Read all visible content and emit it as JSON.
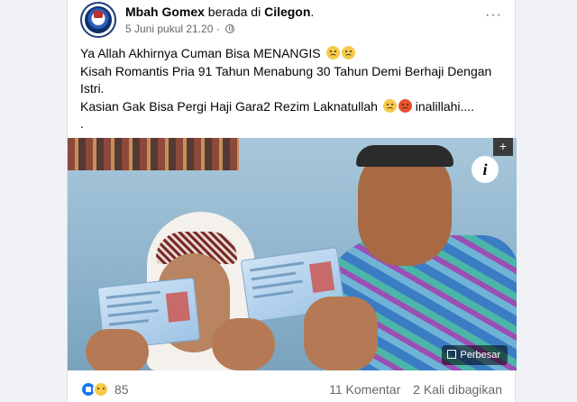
{
  "post": {
    "author": "Mbah Gomex",
    "location_prefix": "berada di",
    "location": "Cilegon",
    "location_suffix": ".",
    "timestamp": "5 Juni pukul 21.20",
    "separator": "·",
    "more_label": "···",
    "text_lines": [
      "Ya Allah Akhirnya Cuman Bisa MENANGIS",
      "Kisah Romantis Pria 91 Tahun Menabung 30 Tahun Demi Berhaji Dengan Istri.",
      "Kasian Gak Bisa Pergi Haji Gara2 Rezim Laknatullah",
      "inalillahi....",
      "."
    ],
    "icons": [
      "globe-icon",
      "more-icon",
      "info-icon",
      "zoom-icon",
      "like-reaction-icon",
      "sad-reaction-icon"
    ]
  },
  "media": {
    "info_label": "i",
    "plus_label": "+",
    "zoom_label": "Perbesar"
  },
  "footer": {
    "reactions_count": "85",
    "comments": "11 Komentar",
    "shares": "2 Kali dibagikan"
  }
}
